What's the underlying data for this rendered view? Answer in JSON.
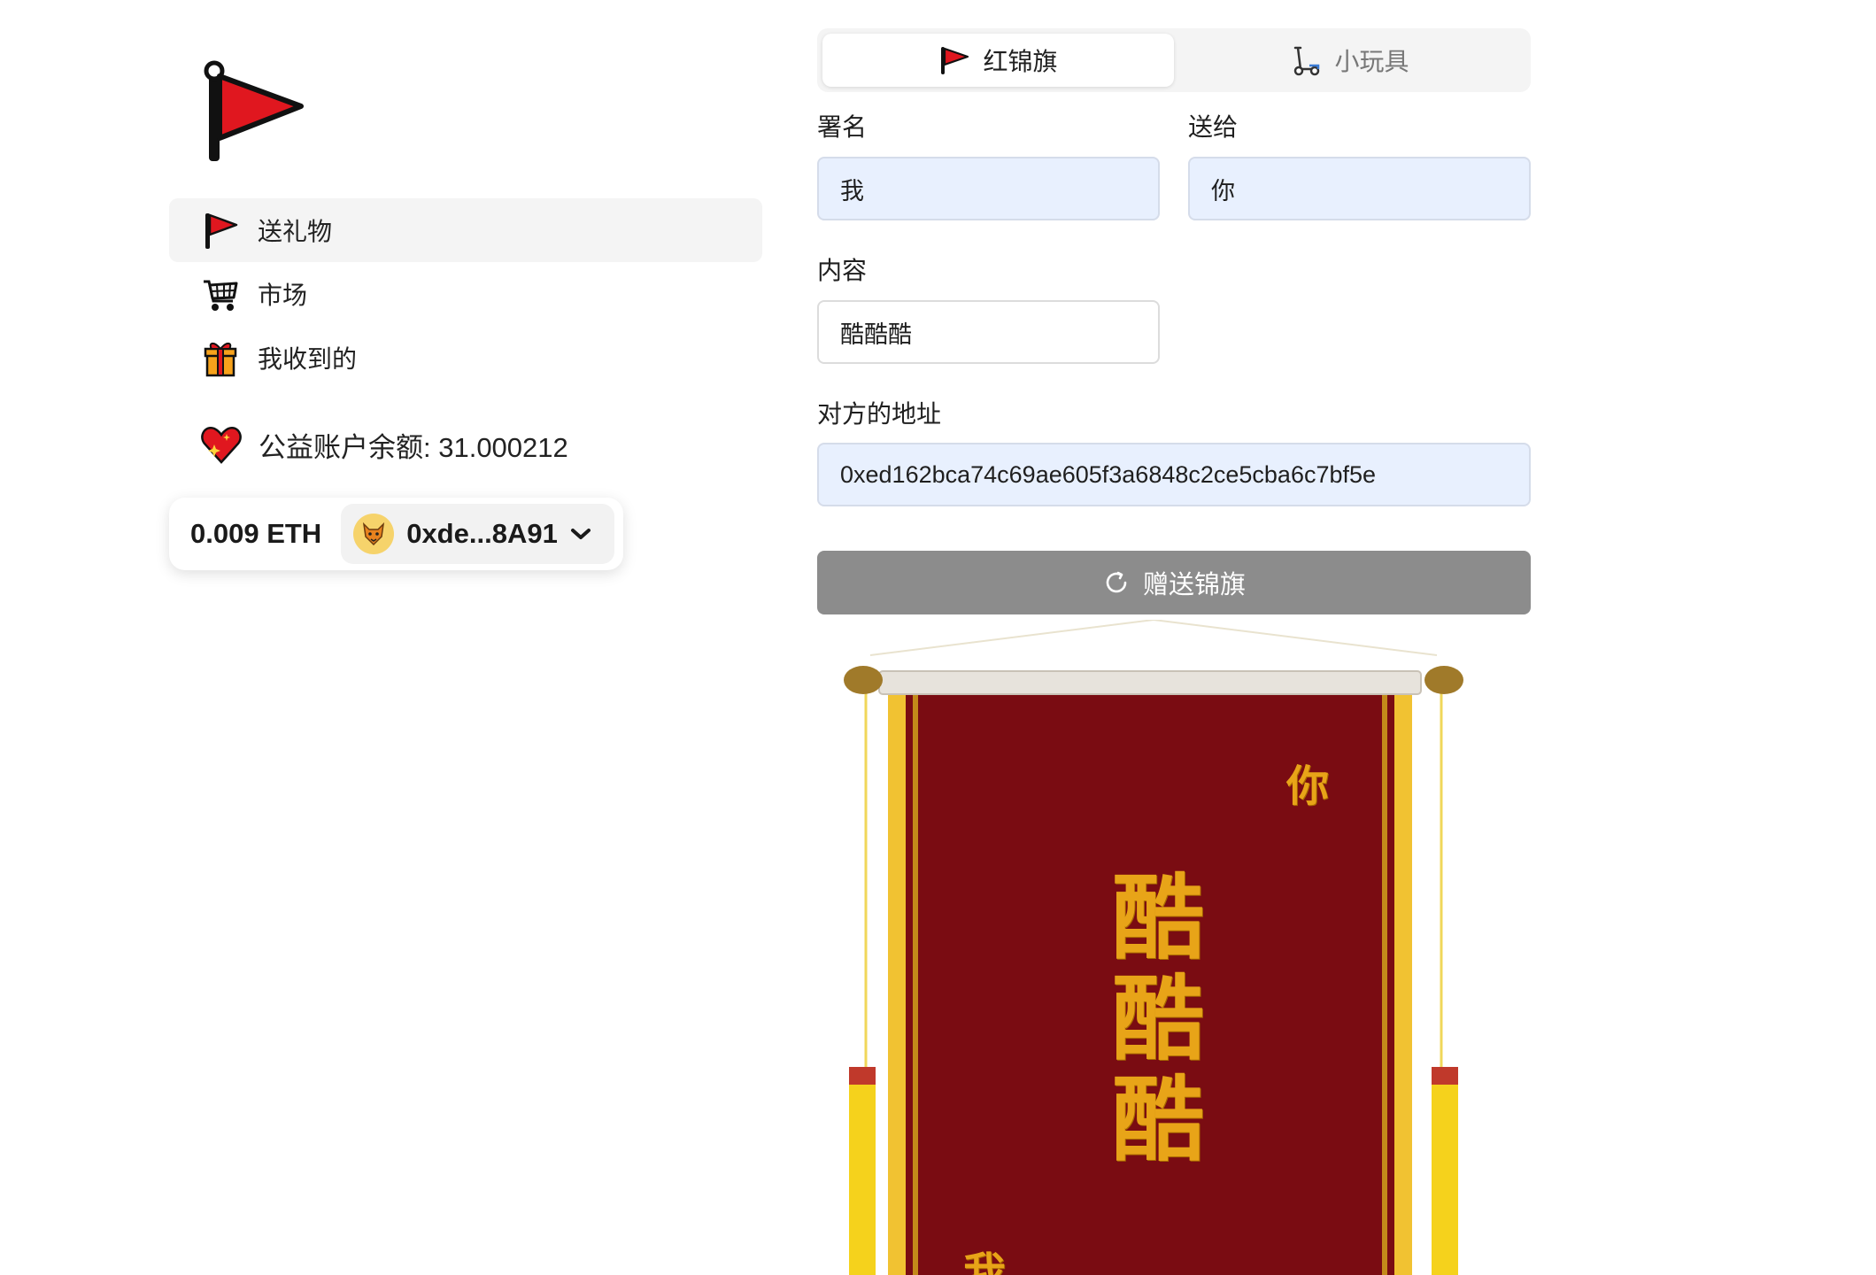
{
  "sidebar": {
    "logo_icon": "red-flag-icon",
    "nav": [
      {
        "label": "送礼物",
        "icon": "red-flag-icon",
        "active": true
      },
      {
        "label": "市场",
        "icon": "shopping-cart-icon",
        "active": false
      },
      {
        "label": "我收到的",
        "icon": "gift-icon",
        "active": false
      }
    ],
    "charity_label": "公益账户余额: 31.000212",
    "charity_icon": "sparkling-heart-icon"
  },
  "wallet": {
    "balance": "0.009 ETH",
    "address": "0xde...8A91",
    "avatar_icon": "fox-avatar-icon"
  },
  "tabs": [
    {
      "label": "红锦旗",
      "icon": "red-flag-icon",
      "active": true
    },
    {
      "label": "小玩具",
      "icon": "scooter-icon",
      "active": false
    }
  ],
  "form": {
    "signature_label": "署名",
    "signature_value": "我",
    "recipient_label": "送给",
    "recipient_value": "你",
    "content_label": "内容",
    "content_value": "酷酷酷",
    "address_label": "对方的地址",
    "address_value": "0xed162bca74c69ae605f3a6848c2ce5cba6c7bf5e",
    "submit_label": "赠送锦旗",
    "submit_icon": "loading-spinner-icon"
  },
  "banner": {
    "to_text": "你",
    "content_text": "酷酷酷",
    "from_text": "我"
  },
  "colors": {
    "accent_red": "#e0171f",
    "banner_red": "#7a0c12",
    "gold": "#e8a418",
    "input_fill": "#e8f0fe",
    "button_disabled": "#8c8c8c"
  }
}
